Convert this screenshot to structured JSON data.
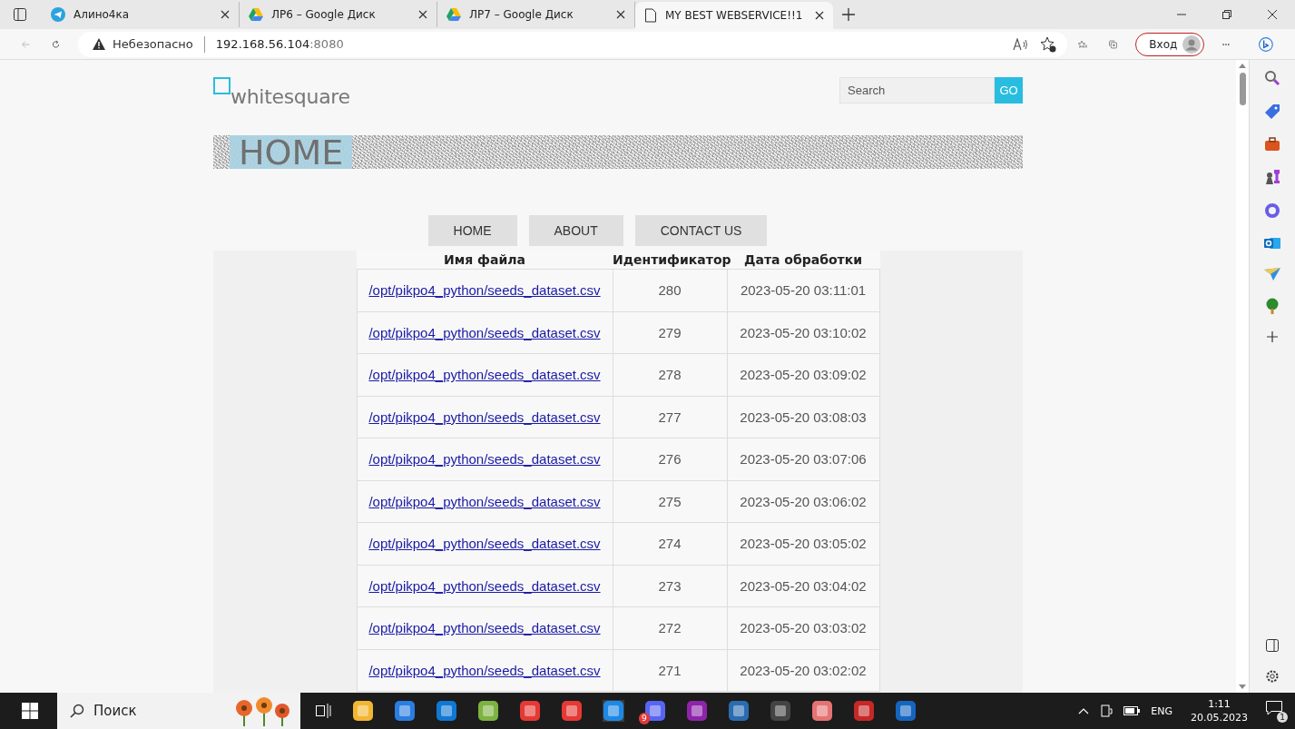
{
  "tabs": [
    {
      "title": "Алино4ка",
      "selected": false
    },
    {
      "title": "ЛР6 – Google Диск",
      "selected": false
    },
    {
      "title": "ЛР7 – Google Диск",
      "selected": false
    },
    {
      "title": "MY BEST WEBSERVICE!!1",
      "selected": true
    }
  ],
  "address_bar": {
    "security": "Небезопасно",
    "host": "192.168.56.104",
    "port": ":8080"
  },
  "profile_button": "Вход",
  "site": {
    "logo": "whitesquare",
    "search": {
      "placeholder": "Search",
      "button": "GO"
    },
    "banner_title": "HOME",
    "nav": [
      {
        "label": "HOME"
      },
      {
        "label": "ABOUT"
      },
      {
        "label": "CONTACT US"
      }
    ]
  },
  "table": {
    "columns": [
      "Имя файла",
      "Идентификатор",
      "Дата обработки"
    ],
    "rows": [
      [
        "/opt/pikpo4_python/seeds_dataset.csv",
        "280",
        "2023-05-20 03:11:01"
      ],
      [
        "/opt/pikpo4_python/seeds_dataset.csv",
        "279",
        "2023-05-20 03:10:02"
      ],
      [
        "/opt/pikpo4_python/seeds_dataset.csv",
        "278",
        "2023-05-20 03:09:02"
      ],
      [
        "/opt/pikpo4_python/seeds_dataset.csv",
        "277",
        "2023-05-20 03:08:03"
      ],
      [
        "/opt/pikpo4_python/seeds_dataset.csv",
        "276",
        "2023-05-20 03:07:06"
      ],
      [
        "/opt/pikpo4_python/seeds_dataset.csv",
        "275",
        "2023-05-20 03:06:02"
      ],
      [
        "/opt/pikpo4_python/seeds_dataset.csv",
        "274",
        "2023-05-20 03:05:02"
      ],
      [
        "/opt/pikpo4_python/seeds_dataset.csv",
        "273",
        "2023-05-20 03:04:02"
      ],
      [
        "/opt/pikpo4_python/seeds_dataset.csv",
        "272",
        "2023-05-20 03:03:02"
      ],
      [
        "/opt/pikpo4_python/seeds_dataset.csv",
        "271",
        "2023-05-20 03:02:02"
      ]
    ]
  },
  "taskbar": {
    "search": "Поиск",
    "app_badge": "9",
    "language": "ENG",
    "time": "1:11",
    "date": "20.05.2023",
    "notifications": "1"
  }
}
